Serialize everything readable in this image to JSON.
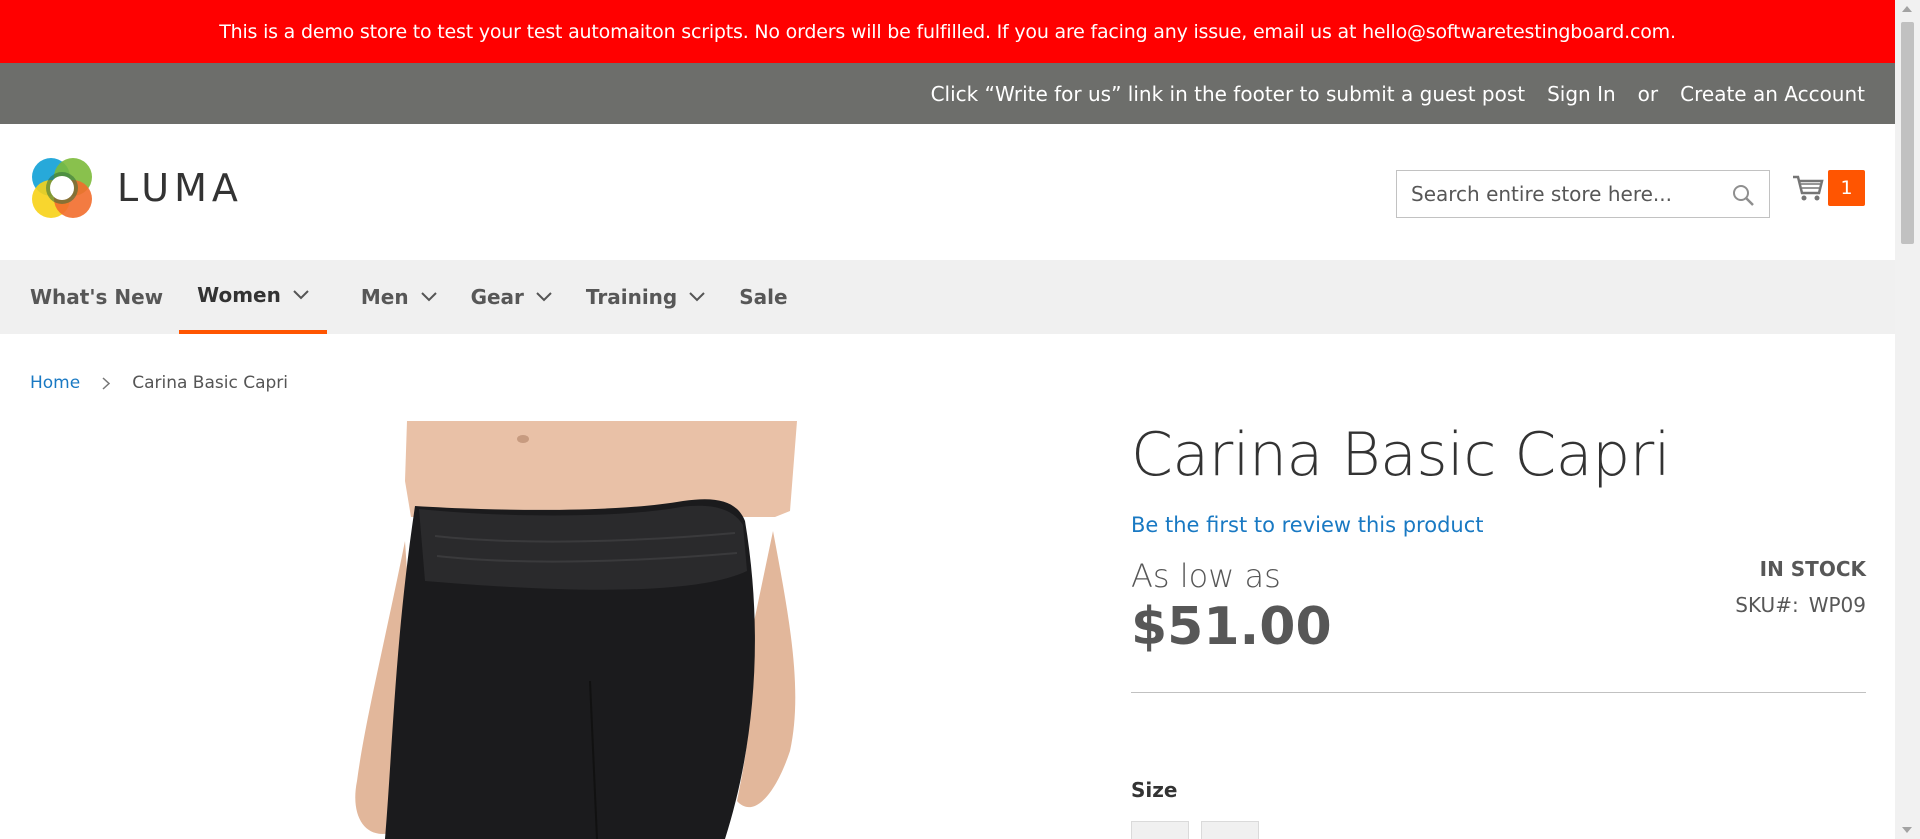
{
  "banner": {
    "text": "This is a demo store to test your test automaiton scripts. No orders will be fulfilled. If you are facing any issue, email us at hello@softwaretestingboard.com."
  },
  "topbar": {
    "promo": "Click “Write for us” link in the footer to submit a guest post",
    "sign_in": "Sign In",
    "or": "or",
    "create_account": "Create an Account"
  },
  "header": {
    "logo_text": "LUMA",
    "search_placeholder": "Search entire store here...",
    "cart_count": "1"
  },
  "nav": {
    "items": [
      {
        "label": "What's New"
      },
      {
        "label": "Women"
      },
      {
        "label": "Men"
      },
      {
        "label": "Gear"
      },
      {
        "label": "Training"
      },
      {
        "label": "Sale"
      }
    ]
  },
  "breadcrumb": {
    "home": "Home",
    "current": "Carina Basic Capri"
  },
  "product": {
    "title": "Carina Basic Capri",
    "review_link": "Be the first to review this product",
    "price_prefix": "As low as",
    "price": "$51.00",
    "stock": "IN STOCK",
    "sku_label": "SKU#:",
    "sku_value": "WP09",
    "size_label": "Size"
  },
  "colors": {
    "banner": "#ff0000",
    "topbar": "#6d6e6b",
    "accent": "#ff5501",
    "link": "#1979c3"
  }
}
